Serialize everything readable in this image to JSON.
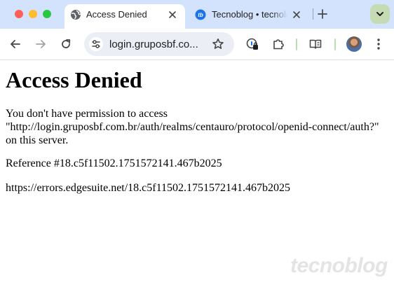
{
  "browser": {
    "tabs": [
      {
        "title": "Access Denied",
        "favicon": "globe-icon",
        "active": true
      },
      {
        "title": "Tecnoblog • tecnologia que interessa",
        "favicon": "tecnoblog-icon",
        "active": false
      }
    ],
    "new_tab_icon": "plus-icon",
    "tab_search_icon": "chevron-down-icon",
    "address_bar": {
      "url": "login.gruposbf.co...",
      "site_info_icon": "tune-icon",
      "bookmark_icon": "star-icon"
    },
    "toolbar_icons": [
      "back-arrow-icon",
      "forward-arrow-icon",
      "reload-icon",
      "password-manager-icon",
      "extensions-icon",
      "reading-list-icon",
      "avatar",
      "kebab-menu-icon"
    ],
    "colors": {
      "tabstrip": "#d3e3fd",
      "omnibox": "#ebeff5",
      "accent_green": "#c4dbb3"
    }
  },
  "page": {
    "heading": "Access Denied",
    "message_line1": "You don't have permission to access",
    "message_line2": "\"http://login.gruposbf.com.br/auth/realms/centauro/protocol/openid-connect/auth?\"",
    "message_line3": "on this server.",
    "reference": "Reference #18.c5f11502.1751572141.467b2025",
    "error_url": "https://errors.edgesuite.net/18.c5f11502.1751572141.467b2025"
  },
  "watermark": {
    "text": "tecnoblog"
  }
}
